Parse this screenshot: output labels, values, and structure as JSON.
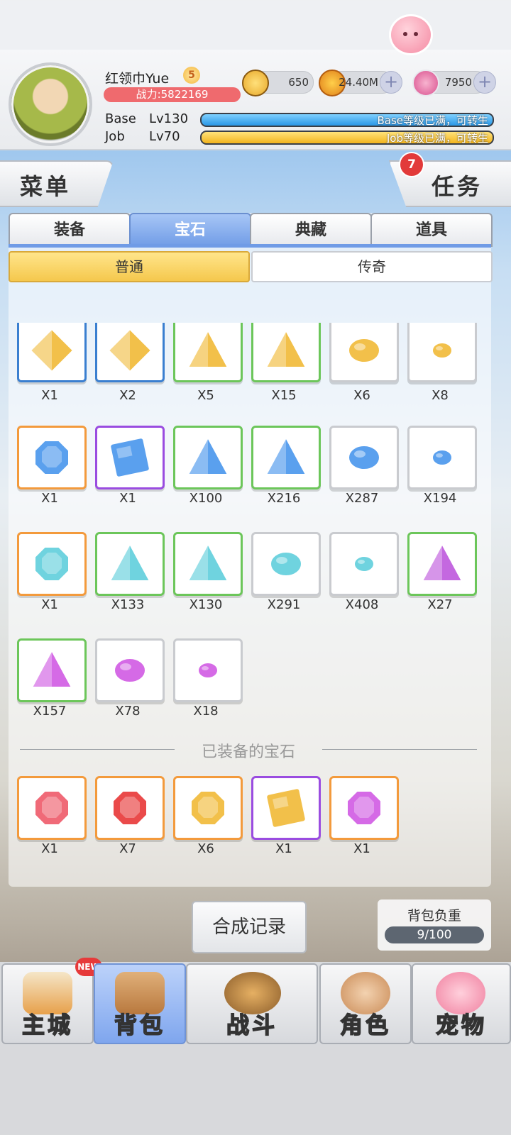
{
  "player": {
    "name": "红领巾Yue",
    "vip_level": "5",
    "combat_power": "战力:5822169",
    "base_label": "Base",
    "base_level": "Lv130",
    "base_status": "Base等级已满，可转生",
    "job_label": "Job",
    "job_level": "Lv70",
    "job_status": "Job等级已满，可转生"
  },
  "currencies": [
    {
      "icon": "zeny-coin-icon",
      "value": "650"
    },
    {
      "icon": "gold-coin-icon",
      "value": "24.40M"
    },
    {
      "icon": "pink-crystal-icon",
      "value": "7950"
    }
  ],
  "menu_label": "菜单",
  "task_label": "任务",
  "task_badge": "7",
  "tabs": [
    "装备",
    "宝石",
    "典藏",
    "道具"
  ],
  "active_tab": "宝石",
  "subtabs": [
    "普通",
    "传奇"
  ],
  "active_subtab": "普通",
  "gems": [
    {
      "count": "X1",
      "shape": "diamond",
      "color": "#f2c04a",
      "border": "#3a7fd0"
    },
    {
      "count": "X2",
      "shape": "diamond",
      "color": "#f2c04a",
      "border": "#3a7fd0"
    },
    {
      "count": "X5",
      "shape": "triangle",
      "color": "#f2c04a",
      "border": "#6cc65a"
    },
    {
      "count": "X15",
      "shape": "triangle",
      "color": "#f2c04a",
      "border": "#6cc65a"
    },
    {
      "count": "X6",
      "shape": "nugget",
      "color": "#f2c04a",
      "border": "#c9cbcf"
    },
    {
      "count": "X8",
      "shape": "nugget-small",
      "color": "#f2c04a",
      "border": "#c9cbcf"
    },
    {
      "count": "X1",
      "shape": "octagon",
      "color": "#5aa0ee",
      "border": "#f39a3c"
    },
    {
      "count": "X1",
      "shape": "square",
      "color": "#5aa0ee",
      "border": "#9a4ce0"
    },
    {
      "count": "X100",
      "shape": "triangle",
      "color": "#5aa0ee",
      "border": "#6cc65a"
    },
    {
      "count": "X216",
      "shape": "triangle",
      "color": "#5aa0ee",
      "border": "#6cc65a"
    },
    {
      "count": "X287",
      "shape": "nugget",
      "color": "#5aa0ee",
      "border": "#c9cbcf"
    },
    {
      "count": "X194",
      "shape": "nugget-small",
      "color": "#5aa0ee",
      "border": "#c9cbcf"
    },
    {
      "count": "X1",
      "shape": "octagon",
      "color": "#6fd3df",
      "border": "#f39a3c"
    },
    {
      "count": "X133",
      "shape": "triangle",
      "color": "#6fd3df",
      "border": "#6cc65a"
    },
    {
      "count": "X130",
      "shape": "triangle",
      "color": "#6fd3df",
      "border": "#6cc65a"
    },
    {
      "count": "X291",
      "shape": "nugget",
      "color": "#6fd3df",
      "border": "#c9cbcf"
    },
    {
      "count": "X408",
      "shape": "nugget-small",
      "color": "#6fd3df",
      "border": "#c9cbcf"
    },
    {
      "count": "X27",
      "shape": "triangle",
      "color": "#c468e0",
      "border": "#6cc65a"
    },
    {
      "count": "X157",
      "shape": "triangle",
      "color": "#d56ae6",
      "border": "#6cc65a"
    },
    {
      "count": "X78",
      "shape": "nugget",
      "color": "#d56ae6",
      "border": "#c9cbcf"
    },
    {
      "count": "X18",
      "shape": "nugget-small",
      "color": "#d56ae6",
      "border": "#c9cbcf"
    }
  ],
  "equipped_title": "已装备的宝石",
  "equipped_gems": [
    {
      "count": "X1",
      "shape": "octagon",
      "color": "#f06a78",
      "border": "#f39a3c"
    },
    {
      "count": "X7",
      "shape": "octagon",
      "color": "#ea4a4a",
      "border": "#f39a3c"
    },
    {
      "count": "X6",
      "shape": "octagon",
      "color": "#f2c04a",
      "border": "#f39a3c"
    },
    {
      "count": "X1",
      "shape": "square",
      "color": "#f2c04a",
      "border": "#9a4ce0"
    },
    {
      "count": "X1",
      "shape": "octagon",
      "color": "#d56ae6",
      "border": "#f39a3c"
    }
  ],
  "synthesis_label": "合成记录",
  "weight": {
    "label": "背包负重",
    "value": "9/100"
  },
  "nav": [
    {
      "label": "主城",
      "icon": "castle-icon"
    },
    {
      "label": "背包",
      "icon": "backpack-icon"
    },
    {
      "label": "战斗",
      "icon": "battle-wheel-icon"
    },
    {
      "label": "角色",
      "icon": "character-icon"
    },
    {
      "label": "宠物",
      "icon": "pet-poring-icon"
    }
  ],
  "new_badge": "NEW"
}
